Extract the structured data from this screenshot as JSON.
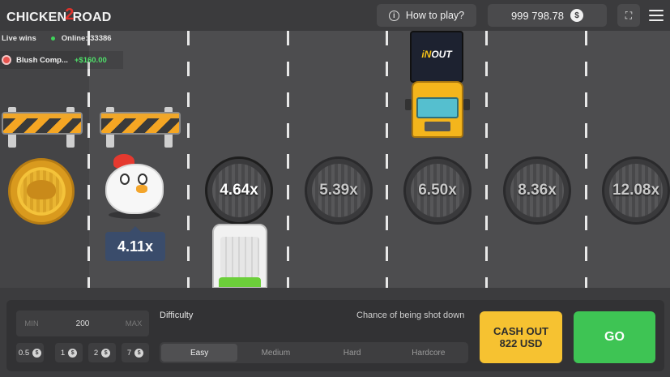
{
  "header": {
    "logo_left": "CHICKEN",
    "logo_num": "2",
    "logo_right": "ROAD",
    "how_to_play": "How to play?",
    "balance": "999 798.78",
    "currency_icon": "dollar-coin-icon"
  },
  "live": {
    "label": "Live wins",
    "online": "Online: 33386",
    "win_user": "Blush Comp...",
    "win_amount": "+$160.00"
  },
  "road": {
    "multipliers": [
      "4.64x",
      "5.39x",
      "6.50x",
      "8.36x",
      "12.08x"
    ],
    "current_multiplier": "4.11x",
    "truck_brand_in": "iN",
    "truck_brand_out": "OUT"
  },
  "controls": {
    "min_label": "MIN",
    "bet_value": "200",
    "max_label": "MAX",
    "chips": [
      "0.5",
      "1",
      "2",
      "7"
    ],
    "chip_icon": "$",
    "difficulty_label": "Difficulty",
    "chance_label": "Chance of being shot down",
    "difficulties": [
      "Easy",
      "Medium",
      "Hard",
      "Hardcore"
    ],
    "selected_difficulty": "Easy",
    "cashout_line1": "CASH OUT",
    "cashout_line2": "822 USD",
    "go_label": "GO"
  },
  "colors": {
    "road": "#4d4d4f",
    "cashout": "#f6c231",
    "go": "#3ec454",
    "multiplier_badge": "#3a4c6b"
  }
}
